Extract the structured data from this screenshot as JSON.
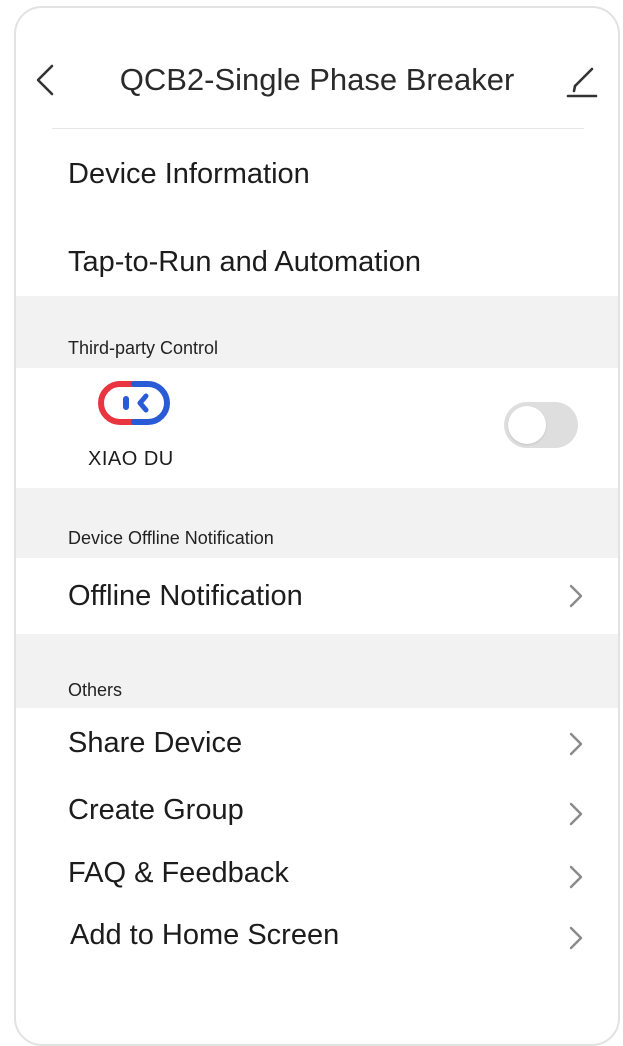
{
  "header": {
    "title": "QCB2-Single Phase Breaker",
    "back_icon": "chevron-left-icon",
    "edit_icon": "edit-pencil-icon"
  },
  "menu": {
    "device_information": "Device Information",
    "tap_to_run": "Tap-to-Run and Automation"
  },
  "third_party": {
    "section_title": "Third-party Control",
    "service_name": "XIAO DU",
    "service_icon": "xiaodu-logo-icon",
    "toggle_on": false
  },
  "offline": {
    "section_title": "Device Offline Notification",
    "item_label": "Offline Notification"
  },
  "others": {
    "section_title": "Others",
    "items": [
      {
        "label": "Share Device"
      },
      {
        "label": "Create Group"
      },
      {
        "label": "FAQ & Feedback"
      },
      {
        "label": "Add to Home Screen"
      }
    ]
  },
  "colors": {
    "section_bg": "#f2f2f2",
    "toggle_off": "#dedede",
    "logo_red": "#e8353f",
    "logo_blue": "#2a5bd7",
    "text": "#1c1c1c",
    "chevron": "#8a8a8a"
  }
}
